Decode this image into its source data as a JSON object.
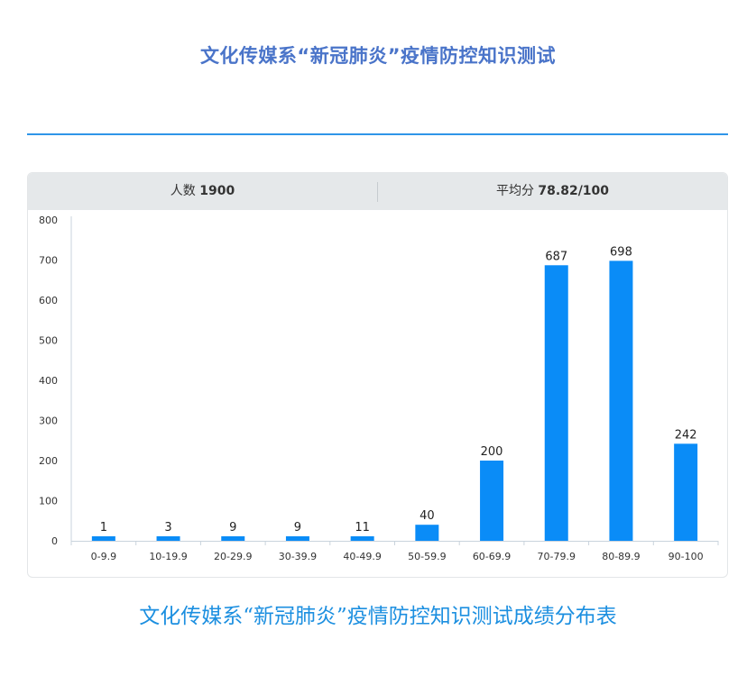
{
  "page_title": "文化传媒系“新冠肺炎”疫情防控知识测试",
  "stats": {
    "count_label": "人数",
    "count_value": "1900",
    "avg_label": "平均分",
    "avg_value": "78.82/100"
  },
  "caption": "文化传媒系“新冠肺炎”疫情防控知识测试成绩分布表",
  "colors": {
    "bar": "#0a8cf7",
    "title": "#4a74c9",
    "caption": "#1c8fe0",
    "rule": "#2f95e8"
  },
  "chart_data": {
    "type": "bar",
    "categories": [
      "0-9.9",
      "10-19.9",
      "20-29.9",
      "30-39.9",
      "40-49.9",
      "50-59.9",
      "60-69.9",
      "70-79.9",
      "80-89.9",
      "90-100"
    ],
    "values": [
      1,
      3,
      9,
      9,
      11,
      40,
      200,
      687,
      698,
      242
    ],
    "title": "",
    "xlabel": "",
    "ylabel": "",
    "ylim": [
      0,
      800
    ],
    "yticks": [
      0,
      100,
      200,
      300,
      400,
      500,
      600,
      700,
      800
    ],
    "grid": false,
    "data_labels": true
  }
}
